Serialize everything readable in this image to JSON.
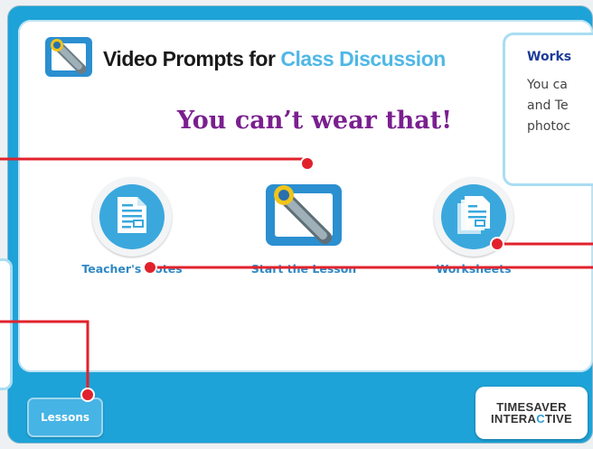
{
  "header": {
    "title_part1": "Video Prompts for ",
    "title_part2": "Class Discussion"
  },
  "lesson": {
    "title": "You can’t wear that!"
  },
  "items": [
    {
      "label": "Teacher's Notes",
      "icon": "document-icon"
    },
    {
      "label": "Start the Lesson",
      "icon": "video-camera-icon"
    },
    {
      "label": "Worksheets",
      "icon": "stacked-documents-icon"
    }
  ],
  "tooltip": {
    "title": "Works",
    "lines": [
      "You ca",
      "and Te",
      "photoc"
    ]
  },
  "footer": {
    "lessons_button": "Lessons",
    "brand_line1": "TIMESAVER",
    "brand_line2_a": "INTERA",
    "brand_line2_b": "C",
    "brand_line2_c": "TIVE"
  },
  "colors": {
    "frame": "#1ea3d8",
    "lesson_title": "#7a1f8f",
    "title_accent": "#4fb8e6",
    "label": "#2f88c4",
    "pointer": "#e1222c"
  }
}
